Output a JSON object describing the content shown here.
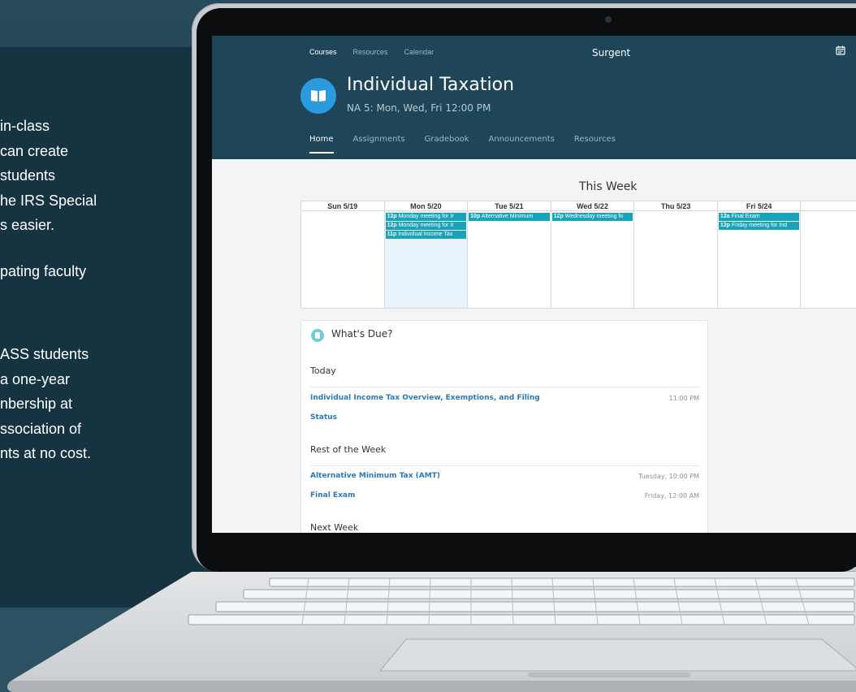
{
  "marketing_copy": {
    "lines_a": [
      "in-class",
      "can create",
      "students",
      "he IRS Special",
      "s easier."
    ],
    "lines_b": [
      "pating faculty"
    ],
    "lines_c": [
      "ASS students",
      "a one-year",
      "nbership at",
      "ssociation of",
      "nts at no cost."
    ]
  },
  "app": {
    "topnav": [
      "Courses",
      "Resources",
      "Calendar"
    ],
    "brand": "Surgent",
    "course": {
      "title": "Individual Taxation",
      "subtitle": "NA 5: Mon, Wed, Fri 12:00 PM"
    },
    "tabs": [
      "Home",
      "Assignments",
      "Gradebook",
      "Announcements",
      "Resources"
    ],
    "active_tab": "Home"
  },
  "calendar": {
    "heading": "This Week",
    "days": [
      {
        "label": "Sun 5/19",
        "events": []
      },
      {
        "label": "Mon 5/20",
        "events": [
          {
            "time": "12p",
            "text": "Monday meeting for Ir"
          },
          {
            "time": "12p",
            "text": "Monday meeting for Ir"
          },
          {
            "time": "11p",
            "text": "Individual Income Tax"
          }
        ]
      },
      {
        "label": "Tue 5/21",
        "events": [
          {
            "time": "10p",
            "text": "Alternative Minimum"
          }
        ]
      },
      {
        "label": "Wed 5/22",
        "events": [
          {
            "time": "12p",
            "text": "Wednesday meeting fo"
          }
        ]
      },
      {
        "label": "Thu 5/23",
        "events": []
      },
      {
        "label": "Fri 5/24",
        "events": [
          {
            "time": "12a",
            "text": "Final Exam"
          },
          {
            "time": "12p",
            "text": "Friday meeting for Ind"
          }
        ]
      },
      {
        "label": "",
        "events": []
      }
    ]
  },
  "whats_due": {
    "title": "What's Due?",
    "today_label": "Today",
    "today_items": [
      {
        "title_line1": "Individual Income Tax Overview, Exemptions, and Filing",
        "title_line2": "Status",
        "time": "11:00 PM"
      }
    ],
    "rest_label": "Rest of the Week",
    "rest_items": [
      {
        "title": "Alternative Minimum Tax (AMT)",
        "time": "Tuesday, 10:00 PM"
      },
      {
        "title": "Final Exam",
        "time": "Friday, 12:00 AM"
      }
    ],
    "next_label": "Next Week"
  },
  "colors": {
    "header_bg": "#1e4558",
    "event_bg": "#1aa3b8",
    "link": "#2a78b8",
    "course_icon_bg": "#2b9be0"
  }
}
